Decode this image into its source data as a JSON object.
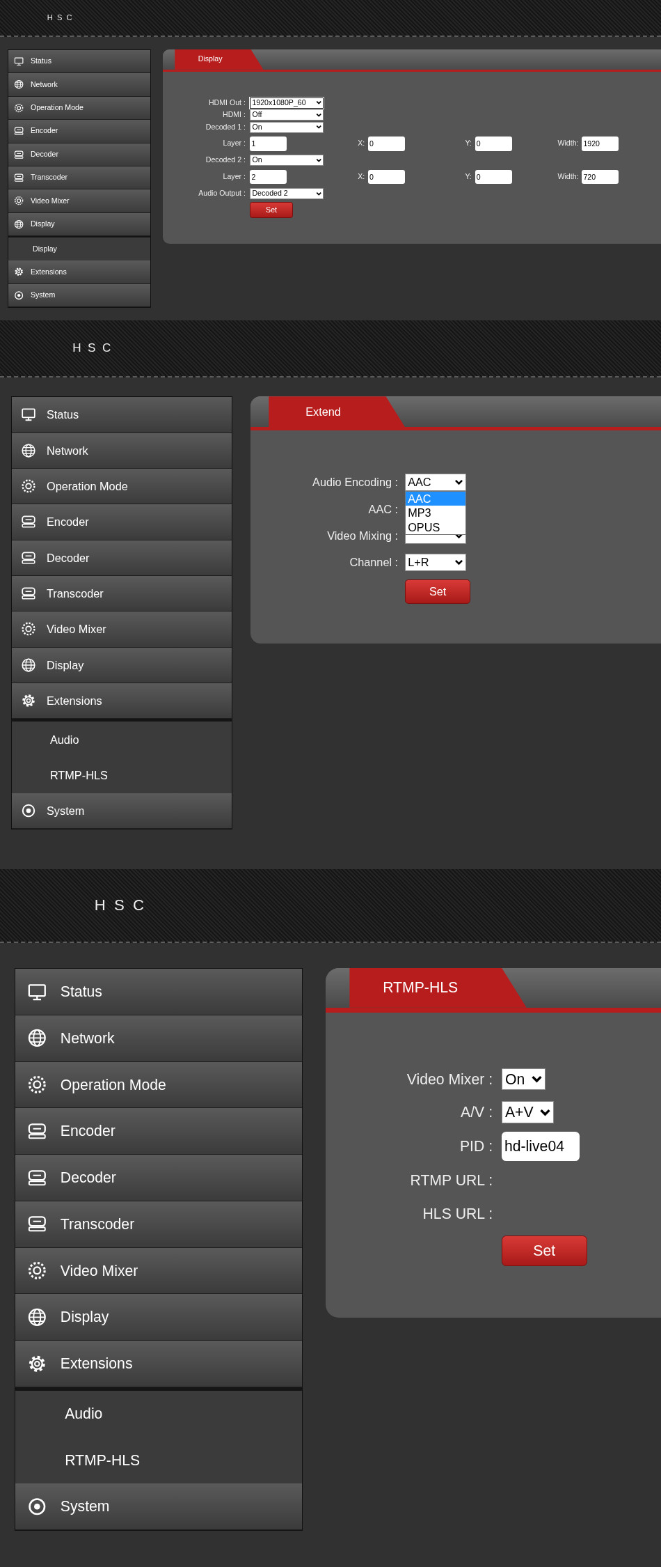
{
  "screens": [
    {
      "logo": "HSC",
      "sidebar": {
        "items": [
          {
            "label": "Status",
            "kind": "monitor"
          },
          {
            "label": "Network",
            "kind": "globe"
          },
          {
            "label": "Operation Mode",
            "kind": "sun"
          },
          {
            "label": "Encoder",
            "kind": "drive"
          },
          {
            "label": "Decoder",
            "kind": "drive"
          },
          {
            "label": "Transcoder",
            "kind": "drive"
          },
          {
            "label": "Video Mixer",
            "kind": "sun"
          },
          {
            "label": "Display",
            "kind": "globe",
            "children": [
              {
                "label": "Display"
              }
            ]
          },
          {
            "label": "Extensions",
            "kind": "gear"
          },
          {
            "label": "System",
            "kind": "target"
          }
        ]
      },
      "panel": {
        "tab": "Display",
        "rows": [
          {
            "label": "HDMI Out :",
            "controls": [
              {
                "kind": "select",
                "value": "1920x1080P_60",
                "focused": true
              }
            ]
          },
          {
            "label": "HDMI :",
            "controls": [
              {
                "kind": "select",
                "value": "Off",
                "focused": false
              }
            ]
          },
          {
            "label": "Decoded 1 :",
            "controls": [
              {
                "kind": "select",
                "value": "On",
                "focused": false
              }
            ]
          },
          {
            "label": "Layer :",
            "controls": [
              {
                "kind": "text",
                "value": "1"
              },
              {
                "kind": "text",
                "label": "X:",
                "value": "0"
              },
              {
                "kind": "text",
                "label": "Y:",
                "value": "0"
              },
              {
                "kind": "text",
                "label": "Width:",
                "value": "1920"
              }
            ]
          },
          {
            "label": "Decoded 2 :",
            "controls": [
              {
                "kind": "select",
                "value": "On",
                "focused": false
              }
            ]
          },
          {
            "label": "Layer :",
            "controls": [
              {
                "kind": "text",
                "value": "2"
              },
              {
                "kind": "text",
                "label": "X:",
                "value": "0"
              },
              {
                "kind": "text",
                "label": "Y:",
                "value": "0"
              },
              {
                "kind": "text",
                "label": "Width:",
                "value": "720"
              }
            ]
          },
          {
            "label": "Audio Output :",
            "controls": [
              {
                "kind": "select",
                "value": "Decoded 2",
                "focused": false
              }
            ]
          }
        ],
        "button": "Set"
      }
    },
    {
      "logo": "HSC",
      "sidebar": {
        "items": [
          {
            "label": "Status",
            "kind": "monitor"
          },
          {
            "label": "Network",
            "kind": "globe"
          },
          {
            "label": "Operation Mode",
            "kind": "sun"
          },
          {
            "label": "Encoder",
            "kind": "drive"
          },
          {
            "label": "Decoder",
            "kind": "drive"
          },
          {
            "label": "Transcoder",
            "kind": "drive"
          },
          {
            "label": "Video Mixer",
            "kind": "sun"
          },
          {
            "label": "Display",
            "kind": "globe"
          },
          {
            "label": "Extensions",
            "kind": "gear",
            "children": [
              {
                "label": "Audio"
              },
              {
                "label": "RTMP-HLS"
              }
            ]
          },
          {
            "label": "System",
            "kind": "target"
          }
        ]
      },
      "panel": {
        "tab": "Extend",
        "rows": [
          {
            "label": "Audio Encoding :",
            "controls": [
              {
                "kind": "select",
                "value": "AAC",
                "focused": false,
                "options": [
                  {
                    "label": "AAC",
                    "selected": true
                  },
                  {
                    "label": "MP3",
                    "selected": false
                  },
                  {
                    "label": "OPUS",
                    "selected": false
                  }
                ]
              }
            ]
          },
          {
            "label": "AAC :",
            "controls": []
          },
          {
            "label": "Video Mixing :",
            "controls": [
              {
                "kind": "select",
                "focused": false
              }
            ]
          },
          {
            "label": "Channel :",
            "controls": [
              {
                "kind": "select",
                "value": "L+R",
                "focused": false
              }
            ]
          }
        ],
        "button": "Set"
      }
    },
    {
      "logo": "HSC",
      "sidebar": {
        "items": [
          {
            "label": "Status",
            "kind": "monitor"
          },
          {
            "label": "Network",
            "kind": "globe"
          },
          {
            "label": "Operation Mode",
            "kind": "sun"
          },
          {
            "label": "Encoder",
            "kind": "drive"
          },
          {
            "label": "Decoder",
            "kind": "drive"
          },
          {
            "label": "Transcoder",
            "kind": "drive"
          },
          {
            "label": "Video Mixer",
            "kind": "sun"
          },
          {
            "label": "Display",
            "kind": "globe"
          },
          {
            "label": "Extensions",
            "kind": "gear",
            "children": [
              {
                "label": "Audio"
              },
              {
                "label": "RTMP-HLS"
              }
            ]
          },
          {
            "label": "System",
            "kind": "target"
          }
        ]
      },
      "panel": {
        "tab": "RTMP-HLS",
        "rows": [
          {
            "label": "Video Mixer :",
            "controls": [
              {
                "kind": "select",
                "value": "On",
                "focused": false
              }
            ]
          },
          {
            "label": "A/V :",
            "controls": [
              {
                "kind": "select",
                "value": "A+V",
                "focused": false
              }
            ]
          },
          {
            "label": "PID :",
            "controls": [
              {
                "kind": "text",
                "value": "hd-live04"
              }
            ]
          },
          {
            "label": "RTMP URL :",
            "controls": []
          },
          {
            "label": "HLS URL :",
            "controls": []
          }
        ],
        "button": "Set"
      }
    }
  ]
}
